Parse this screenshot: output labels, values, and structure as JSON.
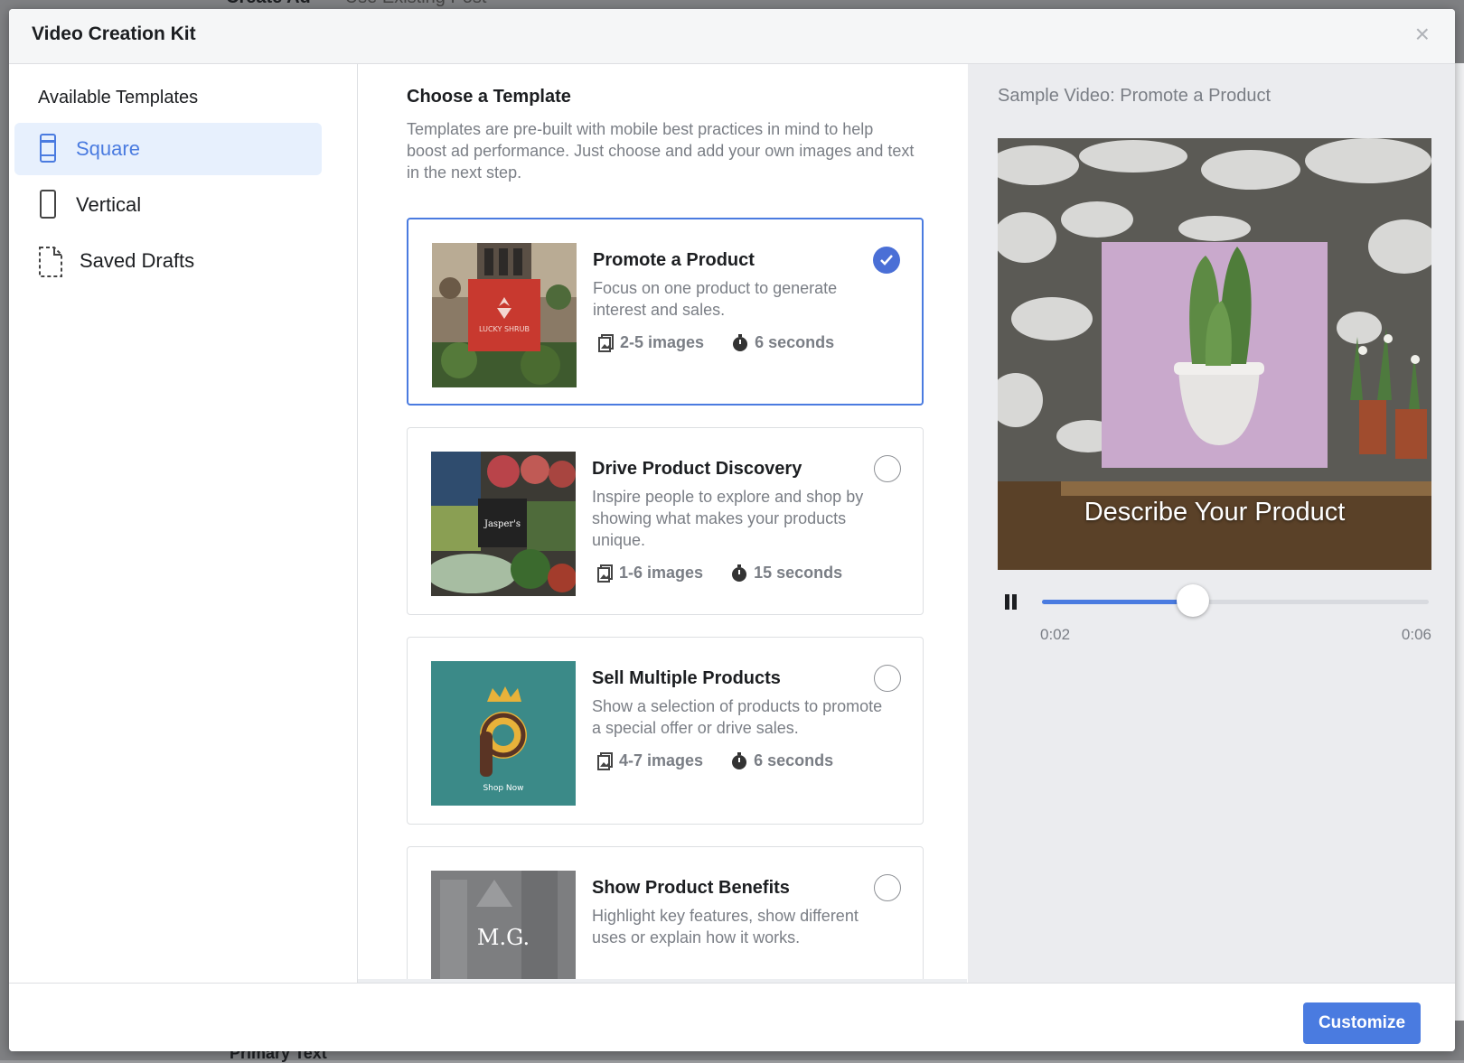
{
  "background": {
    "tabs": [
      "Create Ad",
      "Use Existing Post"
    ],
    "bottom_label": "Primary Text"
  },
  "modal": {
    "title": "Video Creation Kit",
    "close_icon": "close-icon"
  },
  "sidebar": {
    "title": "Available Templates",
    "items": [
      {
        "label": "Square",
        "icon": "square-format-icon",
        "active": true
      },
      {
        "label": "Vertical",
        "icon": "vertical-format-icon",
        "active": false
      },
      {
        "label": "Saved Drafts",
        "icon": "document-icon",
        "active": false
      }
    ]
  },
  "main": {
    "title": "Choose a Template",
    "description": "Templates are pre-built with mobile best practices in mind to help boost ad performance. Just choose and add your own images and text in the next step.",
    "templates": [
      {
        "title": "Promote a Product",
        "description": "Focus on one product to generate interest and sales.",
        "images": "2-5 images",
        "duration": "6 seconds",
        "selected": true,
        "thumb_text": "LUCKY SHRUB"
      },
      {
        "title": "Drive Product Discovery",
        "description": "Inspire people to explore and shop by showing what makes your products unique.",
        "images": "1-6 images",
        "duration": "15 seconds",
        "selected": false,
        "thumb_text": "Jasper's"
      },
      {
        "title": "Sell Multiple Products",
        "description": "Show a selection of products to promote a special offer or drive sales.",
        "images": "4-7 images",
        "duration": "6 seconds",
        "selected": false,
        "thumb_text": "Shop Now"
      },
      {
        "title": "Show Product Benefits",
        "description": "Highlight key features, show different uses or explain how it works.",
        "images": "",
        "duration": "",
        "selected": false,
        "thumb_text": "M.G."
      }
    ]
  },
  "preview": {
    "title": "Sample Video: Promote a Product",
    "caption": "Describe Your Product",
    "current_time": "0:02",
    "total_time": "0:06",
    "progress": 0.39
  },
  "footer": {
    "customize_label": "Customize"
  },
  "colors": {
    "accent": "#4a7be0",
    "selected_check": "#4a6fd6",
    "muted_text": "#7a7e85"
  }
}
